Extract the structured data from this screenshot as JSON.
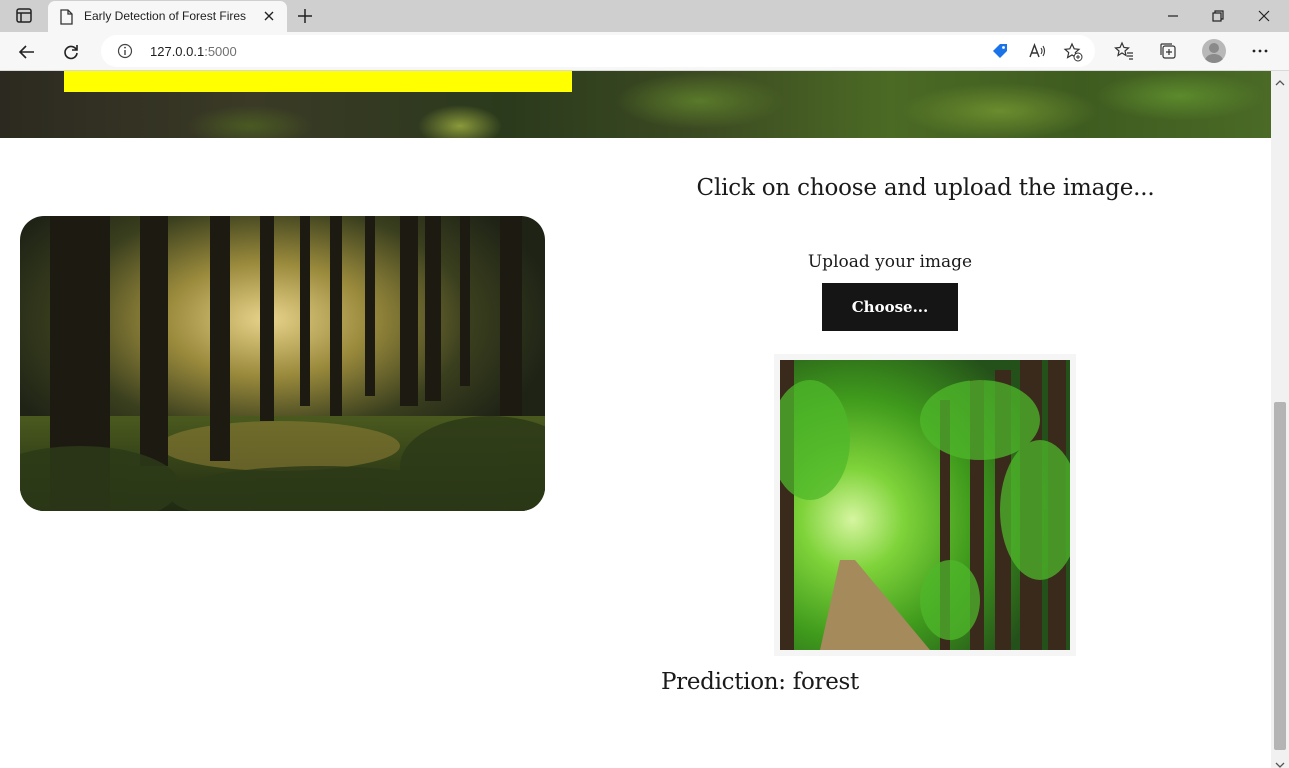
{
  "browser": {
    "tab_title": "Early Detection of Forest Fires",
    "url_host": "127.0.0.1",
    "url_port": ":5000",
    "icons": [
      "tab-actions-icon",
      "page-icon",
      "close-icon",
      "new-tab-icon",
      "minimize-icon",
      "restore-icon",
      "window-close-icon",
      "back-icon",
      "refresh-icon",
      "info-icon",
      "shopping-tag-icon",
      "read-aloud-icon",
      "add-favorite-icon",
      "favorites-icon",
      "collections-icon",
      "profile-avatar",
      "more-icon"
    ]
  },
  "page": {
    "heading": "Click on choose and upload the image...",
    "upload_label": "Upload your image",
    "choose_button": "Choose...",
    "prediction_text": "Prediction: forest",
    "hero_band_color": "#ffff00",
    "button_color": "#151515"
  }
}
